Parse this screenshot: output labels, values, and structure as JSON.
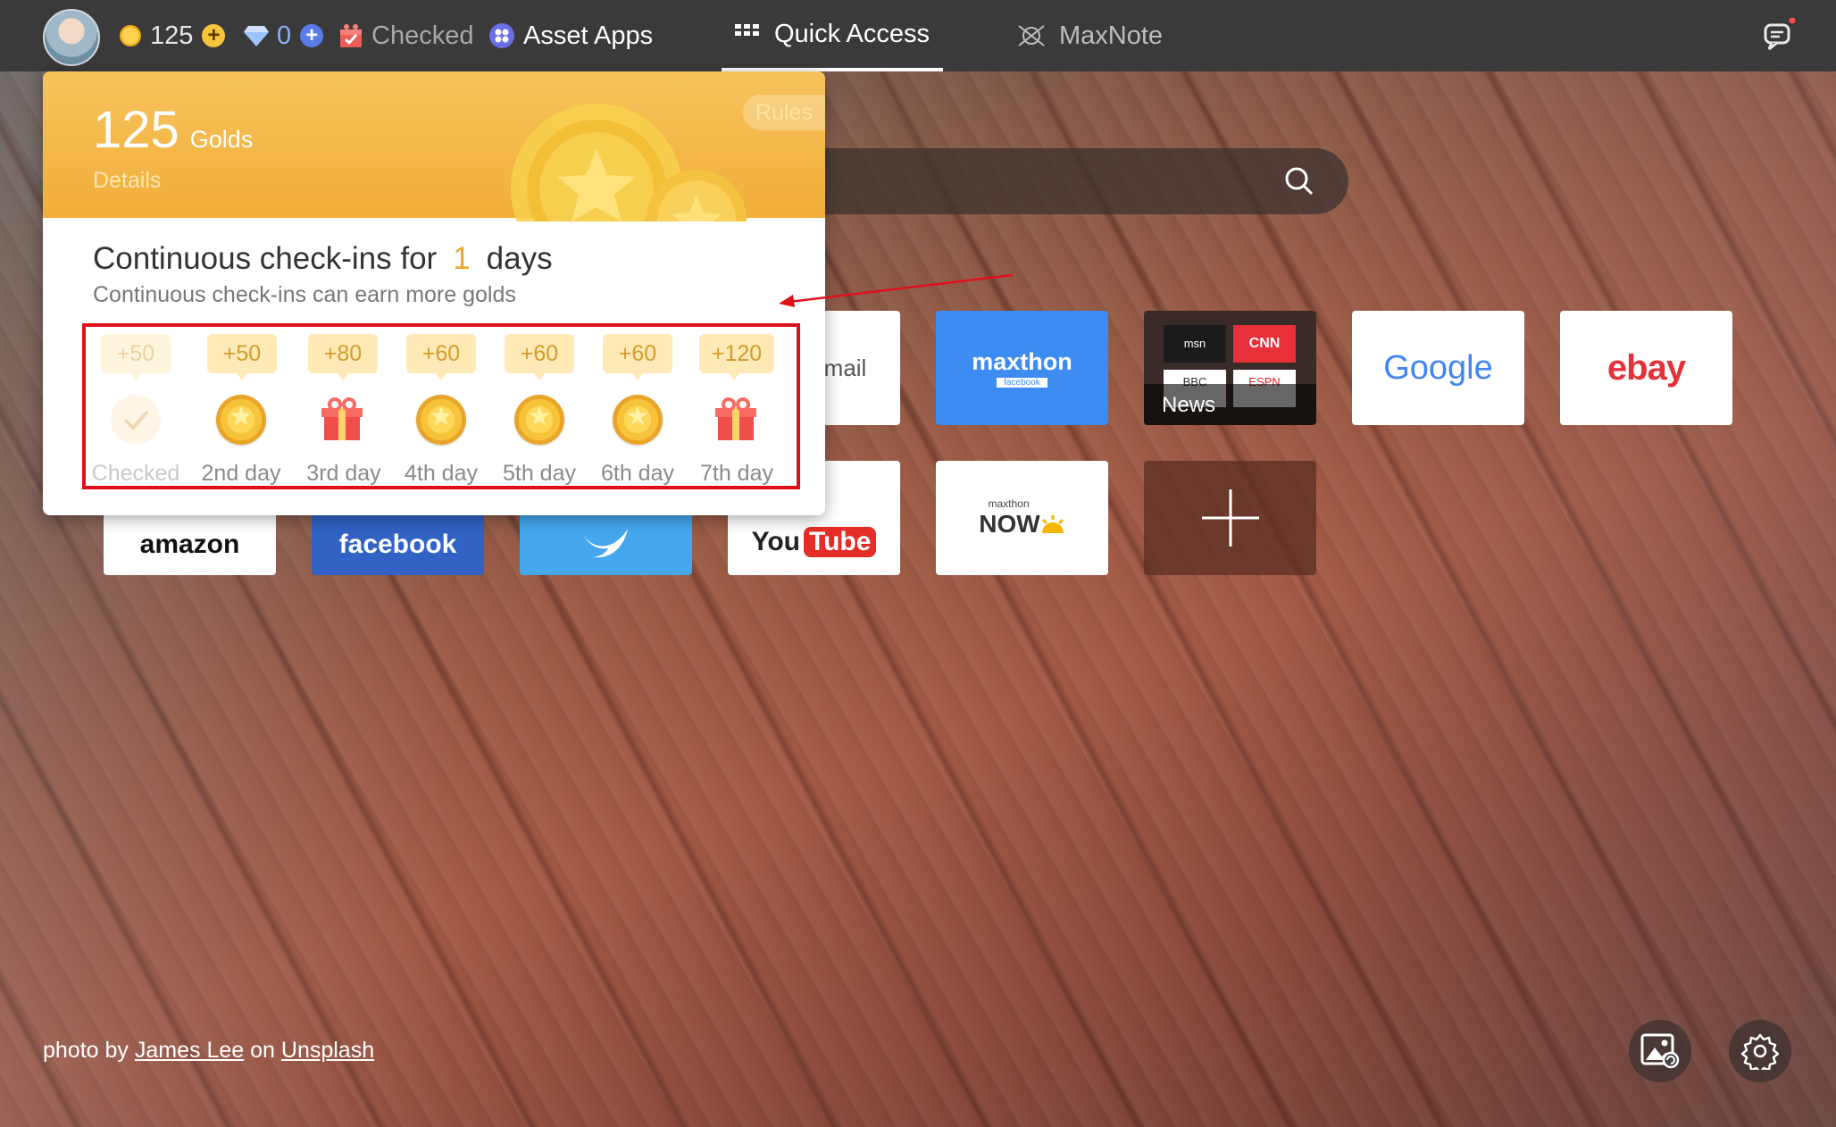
{
  "topbar": {
    "gold_count": "125",
    "diamond_count": "0",
    "checked_label": "Checked",
    "asset_apps_label": "Asset Apps",
    "quick_access_label": "Quick Access",
    "maxnote_label": "MaxNote"
  },
  "search": {
    "placeholder": ""
  },
  "tiles": {
    "mail": "mail",
    "maxthon": "maxthon",
    "maxthon_sub": "facebook",
    "news": "News",
    "msn": "msn",
    "cnn": "CNN",
    "bbc": "BBC",
    "espn": "ESPN",
    "google": "Google",
    "ebay": "ebay",
    "amazon": "amazon",
    "facebook": "facebook",
    "youtube_you": "You",
    "youtube_tube": "Tube",
    "now_small": "maxthon",
    "now_big": "NOW"
  },
  "popup": {
    "gold_amount": "125",
    "gold_unit": "Golds",
    "details_label": "Details",
    "rules_label": "Rules",
    "streak_prefix": "Continuous check-ins for",
    "streak_days": "1",
    "streak_suffix": "days",
    "subtitle": "Continuous check-ins can earn more golds",
    "rewards": [
      {
        "amount": "+50",
        "label": "Checked",
        "icon": "checkmark-icon"
      },
      {
        "amount": "+50",
        "label": "2nd day",
        "icon": "gold-coin-icon"
      },
      {
        "amount": "+80",
        "label": "3rd day",
        "icon": "gift-icon"
      },
      {
        "amount": "+60",
        "label": "4th day",
        "icon": "gold-coin-icon"
      },
      {
        "amount": "+60",
        "label": "5th day",
        "icon": "gold-coin-icon"
      },
      {
        "amount": "+60",
        "label": "6th day",
        "icon": "gold-coin-icon"
      },
      {
        "amount": "+120",
        "label": "7th day",
        "icon": "gift-icon"
      }
    ]
  },
  "credit": {
    "prefix": "photo by",
    "author": "James Lee",
    "middle": "on",
    "site": "Unsplash"
  },
  "colors": {
    "accent_orange": "#f1ae39",
    "highlight_red": "#e0101a",
    "topbar": "#3a3a3a"
  }
}
